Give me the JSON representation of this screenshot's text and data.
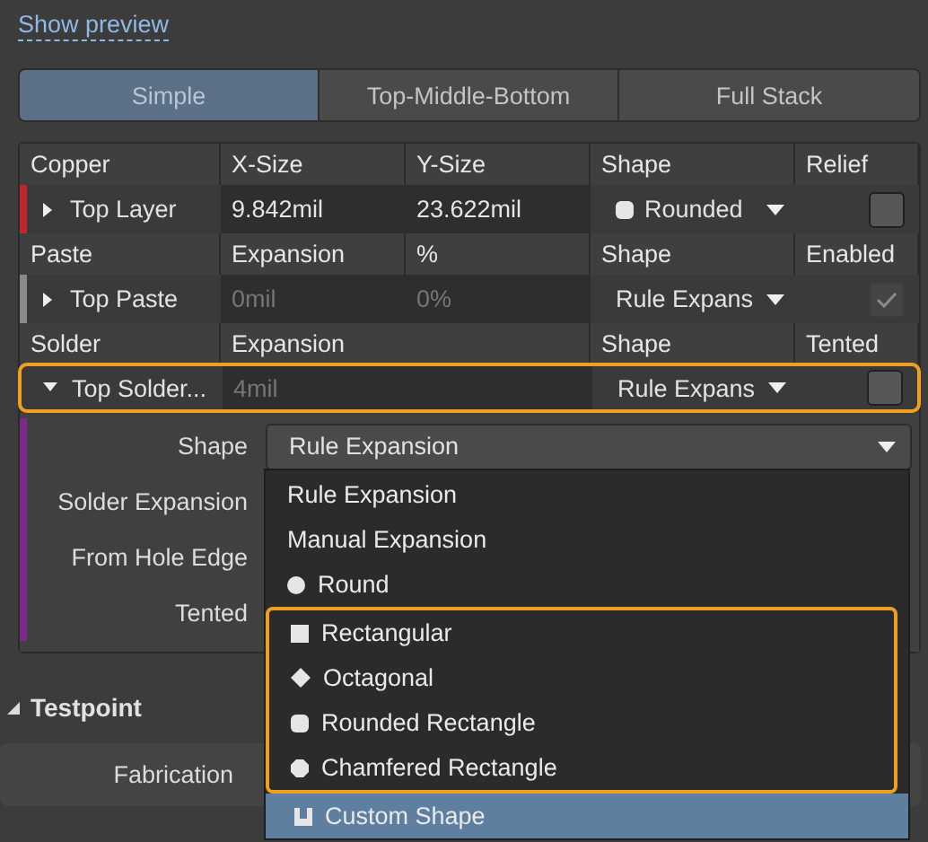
{
  "link": "Show preview",
  "tabs": [
    {
      "label": "Simple",
      "selected": true
    },
    {
      "label": "Top-Middle-Bottom",
      "selected": false
    },
    {
      "label": "Full Stack",
      "selected": false
    }
  ],
  "groups": [
    {
      "headers": [
        {
          "text": "Copper",
          "wide": false
        },
        {
          "text": "X-Size",
          "wide": false
        },
        {
          "text": "Y-Size",
          "wide": false
        },
        {
          "text": "Shape",
          "wide": false
        },
        {
          "text": "Relief",
          "wide": false
        }
      ],
      "row": {
        "name": "Top Layer",
        "expanded": false,
        "highlighted": false,
        "color": "#c0272d",
        "cells": [
          {
            "text": "9.842mil",
            "muted": false,
            "wide": false
          },
          {
            "text": "23.622mil",
            "muted": false,
            "wide": false
          }
        ],
        "shape": {
          "text": "Rounded",
          "kind": "rounded"
        },
        "checked": false,
        "disabled": false
      }
    },
    {
      "headers": [
        {
          "text": "Paste",
          "wide": false
        },
        {
          "text": "Expansion",
          "wide": false
        },
        {
          "text": "%",
          "wide": false
        },
        {
          "text": "Shape",
          "wide": false
        },
        {
          "text": "Enabled",
          "wide": false
        }
      ],
      "row": {
        "name": "Top Paste",
        "expanded": false,
        "highlighted": false,
        "color": "#8a8a8a",
        "cells": [
          {
            "text": "0mil",
            "muted": true,
            "wide": false
          },
          {
            "text": "0%",
            "muted": true,
            "wide": false
          }
        ],
        "shape": {
          "text": "Rule Expans",
          "kind": "text"
        },
        "checked": true,
        "disabled": true
      }
    },
    {
      "headers": [
        {
          "text": "Solder",
          "wide": false
        },
        {
          "text": "Expansion",
          "wide": true
        },
        {
          "text": "Shape",
          "wide": false
        },
        {
          "text": "Tented",
          "wide": false
        }
      ],
      "row": {
        "name": "Top Solder...",
        "expanded": true,
        "highlighted": true,
        "cells": [
          {
            "text": "4mil",
            "muted": true,
            "wide": true
          }
        ],
        "shape": {
          "text": "Rule Expans",
          "kind": "text"
        },
        "checked": false,
        "disabled": false
      }
    }
  ],
  "details": {
    "color": "#7b2a8a",
    "fields": [
      {
        "label": "Shape",
        "kind": "select",
        "value": "Rule Expansion"
      },
      {
        "label": "Solder Expansion",
        "kind": "label"
      },
      {
        "label": "From Hole Edge",
        "kind": "label"
      },
      {
        "label": "Tented",
        "kind": "label"
      }
    ]
  },
  "dropdown": {
    "items": [
      {
        "text": "Rule Expansion",
        "kind": "text",
        "selected": false,
        "highlighted": false
      },
      {
        "text": "Manual Expansion",
        "kind": "text",
        "selected": false,
        "highlighted": false
      },
      {
        "text": "Round",
        "kind": "round",
        "selected": false,
        "highlighted": false
      },
      {
        "text": "Rectangular",
        "kind": "square",
        "selected": false,
        "highlighted": true
      },
      {
        "text": "Octagonal",
        "kind": "diamond",
        "selected": false,
        "highlighted": true
      },
      {
        "text": "Rounded Rectangle",
        "kind": "rounded",
        "selected": false,
        "highlighted": true
      },
      {
        "text": "Chamfered Rectangle",
        "kind": "chamfered",
        "selected": false,
        "highlighted": true
      },
      {
        "text": "Custom Shape",
        "kind": "custom",
        "selected": true,
        "highlighted": false
      }
    ]
  },
  "section": {
    "title": "Testpoint",
    "expanded": true,
    "fields": [
      "Fabrication"
    ]
  }
}
